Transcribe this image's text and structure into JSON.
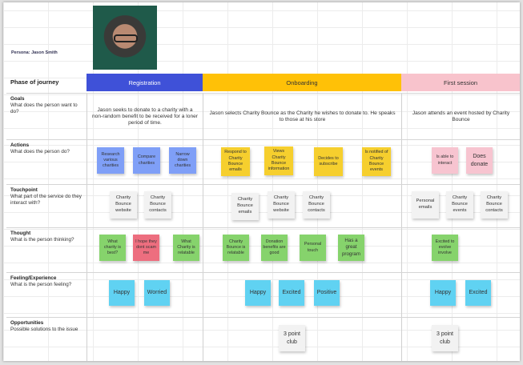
{
  "persona": {
    "label": "Persona: Jason Smith"
  },
  "header": {
    "row_label": "Phase of journey",
    "phases": [
      {
        "name": "Registration",
        "color": "#3f51d8",
        "text_color": "#ffffff"
      },
      {
        "name": "Onboarding",
        "color": "#ffc107",
        "text_color": "#333333"
      },
      {
        "name": "First session",
        "color": "#f8c3cc",
        "text_color": "#333333"
      }
    ]
  },
  "rows": {
    "goals": {
      "title": "Goals",
      "subtitle": "What does the person want to do?",
      "cells": [
        "Jason seeks to donate to a charity with a non-random benefit to be received for a loner period of time.",
        "Jason selects Charity Bounce as the Charity he wishes to donate to. He speaks to those at his store",
        "Jason attends an event hosted by Charity Bounce"
      ]
    },
    "actions": {
      "title": "Actions",
      "subtitle": "What does the person do?",
      "notes": [
        [
          "Research various charities",
          "Compare charities",
          "Narrow down charities"
        ],
        [
          "Respond to Charity Bounce emails",
          "Views Charity Bounce information",
          "Decides to subscribe",
          "Is notified of Charity Bounce events"
        ],
        [
          "Is able to interact",
          "Does donate"
        ]
      ]
    },
    "touchpoint": {
      "title": "Touchpoint",
      "subtitle": "What part of the service do they interact with?",
      "notes": [
        [
          "Charity Bounce website",
          "Charity Bounce contacts"
        ],
        [
          "Charity Bounce emails",
          "Charity Bounce website",
          "Charity Bounce contacts"
        ],
        [
          "Personal emails",
          "Charity Bounce events",
          "Charity Bounce contacts"
        ]
      ]
    },
    "thought": {
      "title": "Thought",
      "subtitle": "What is the person thinking?",
      "notes": [
        [
          "What charity is best?",
          "I hope they dont scam me",
          "What Charity is relatable"
        ],
        [
          "Charity Bounce is relatable",
          "Donation benefits are good",
          "Personal touch",
          "Has a great program"
        ],
        [
          "Excited to evolve involve"
        ]
      ]
    },
    "feeling": {
      "title": "Feeling/Experience",
      "subtitle": "What is the person feeling?",
      "notes": [
        [
          "Happy",
          "Worried"
        ],
        [
          "Happy",
          "Excited",
          "Positive"
        ],
        [
          "Happy",
          "Excited"
        ]
      ]
    },
    "opportunities": {
      "title": "Opportunities",
      "subtitle": "Possible solutions to the issue",
      "notes": [
        [],
        [
          "3 point club"
        ],
        [
          "3 point club"
        ]
      ]
    }
  }
}
